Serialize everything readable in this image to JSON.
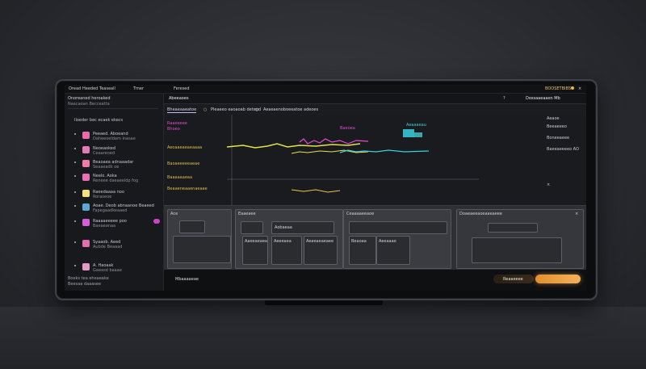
{
  "topbar": {
    "menu": [
      "Oread",
      "Heeded",
      "Teaseall",
      "Tmer"
    ],
    "center": "Feresed",
    "status": "BOOSETBIBS"
  },
  "sidebar": {
    "title": "Onoreaned heroaked",
    "subtitle": "Naacaoan Becceatta",
    "section": "Iloeder bec ecaek ekecs",
    "items": [
      {
        "label": "Peeaed. Aboeand",
        "sub": "Daheeoeldam inasae",
        "color": "#e86aa8"
      },
      {
        "label": "Neoeaoked",
        "sub": "Ceaareoed",
        "color": "#e27bb6"
      },
      {
        "label": "Beaoaea adnaaadar",
        "sub": "Seaaeadk oe",
        "color": "#f07ca4"
      },
      {
        "label": "Neelo. Aoka",
        "sub": "Reneee daeaeeldp fog",
        "color": "#e870b4"
      },
      {
        "label": "Raeedaaaa noo",
        "sub": "Roraseoe",
        "color": "#f2e47a"
      },
      {
        "label": "Aoae. Deob abnaanoe Beaeed",
        "sub": "Fapegaadkeaaed",
        "color": "#5aa6d6"
      },
      {
        "label": "Raaaaeeeee poo",
        "sub": "Baeaeanaa",
        "color": "#d25fd6"
      },
      {
        "label": "Syaaob. Aeed",
        "sub": "Aubde Beaaad",
        "color": "#e06fae"
      },
      {
        "label": "A. Haoaak",
        "sub": "Gaeasd baaae",
        "color": "#e49ac6"
      }
    ],
    "footer": [
      "Boeks tea eheaeake",
      "Beesaa daaasee"
    ]
  },
  "main": {
    "header_title": "Abeeaoes",
    "header_right": "Dossaaeaaen Mb",
    "tabs": [
      "Bheaeaaeatoe",
      "Pleaeeo eaoaoab deteod",
      "Aeaeaenoboeeatoe adeoes"
    ],
    "track_labels": [
      "Raaeeeee",
      "Bhoeo",
      "Aeoaaeaeaeaaaa",
      "Baoaeeeeeaeae",
      "Baaaaaaeaa",
      "Beaaeneaaenaeaae"
    ],
    "chart_values": [
      "Aeaaaeau",
      "Baeoea"
    ],
    "right_info": [
      "Aeaoe",
      "Beeaeeeo",
      "Boneeaeee",
      "Baeeaeeeeo AO"
    ],
    "editor": {
      "panel1_title": "Ace",
      "panel2_title": "Eaaeaee",
      "panel3_title": "Ceaaaaeeaoe",
      "panel4_title": "Doaeaeeaoeaaeaeee",
      "boxes": [
        "Aobaeaa",
        "Aaeeaeaea",
        "Aeeeaea",
        "Aeaeaeaeaee",
        "Beaoaa",
        "Aeeaaao"
      ]
    },
    "footer_left": "Mbaaaaeae",
    "footer_secondary": "Reaaeeee",
    "footer_primary": ""
  },
  "colors": {
    "accent_yellow": "#e6e14a",
    "accent_cyan": "#3ad0e0",
    "accent_magenta": "#e44bd8",
    "accent_orange": "#f2a44a"
  }
}
